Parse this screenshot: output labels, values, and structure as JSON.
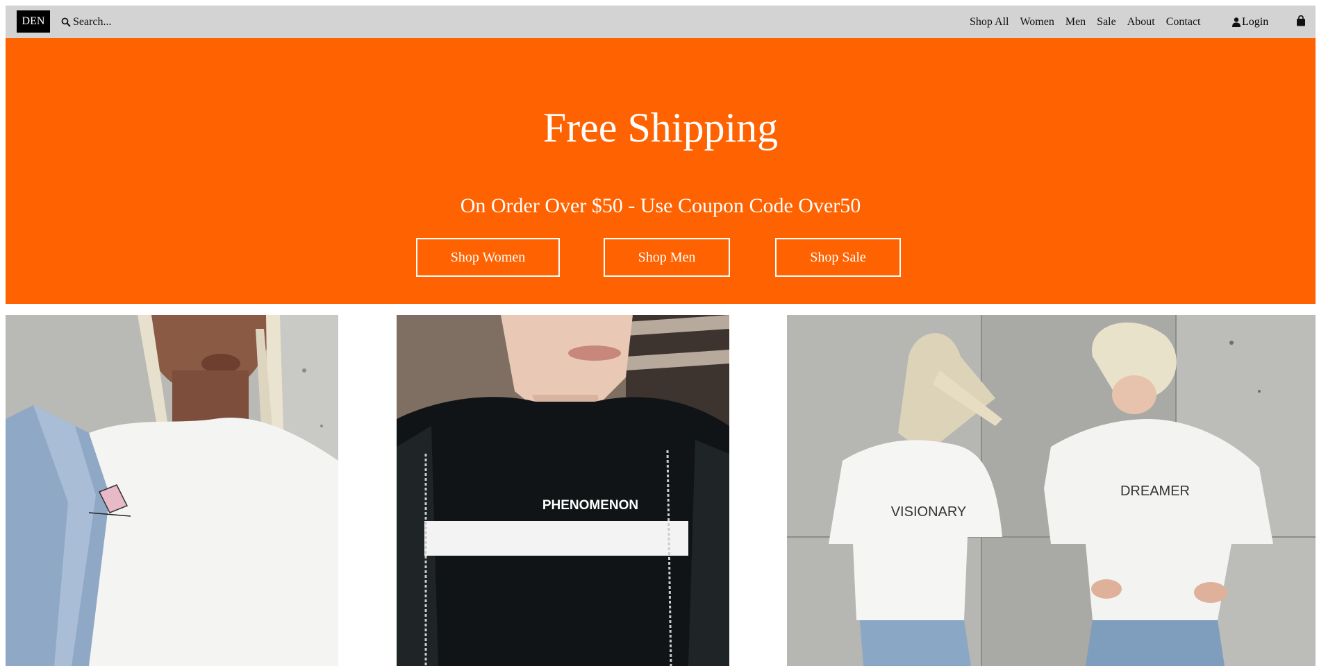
{
  "header": {
    "logo": "DEN",
    "search_placeholder": "Search...",
    "nav": [
      "Shop All",
      "Women",
      "Men",
      "Sale",
      "About",
      "Contact"
    ],
    "login_label": "Login",
    "icons": {
      "search": "search-icon",
      "user": "user-icon",
      "cart": "shopping-bag-icon"
    }
  },
  "hero": {
    "title": "Free Shipping",
    "subtitle": "On Order Over $50 - Use Coupon Code Over50",
    "buttons": [
      "Shop Women",
      "Shop Men",
      "Shop Sale"
    ],
    "background": "#ff6200"
  },
  "gallery": {
    "tiles": [
      {
        "shirt_print": ""
      },
      {
        "shirt_print": "PHENOMENON"
      },
      {
        "shirt_print_left": "VISIONARY",
        "shirt_print_right": "DREAMER"
      }
    ]
  },
  "colors": {
    "header_bg": "#d3d3d3",
    "accent": "#ff6200"
  }
}
